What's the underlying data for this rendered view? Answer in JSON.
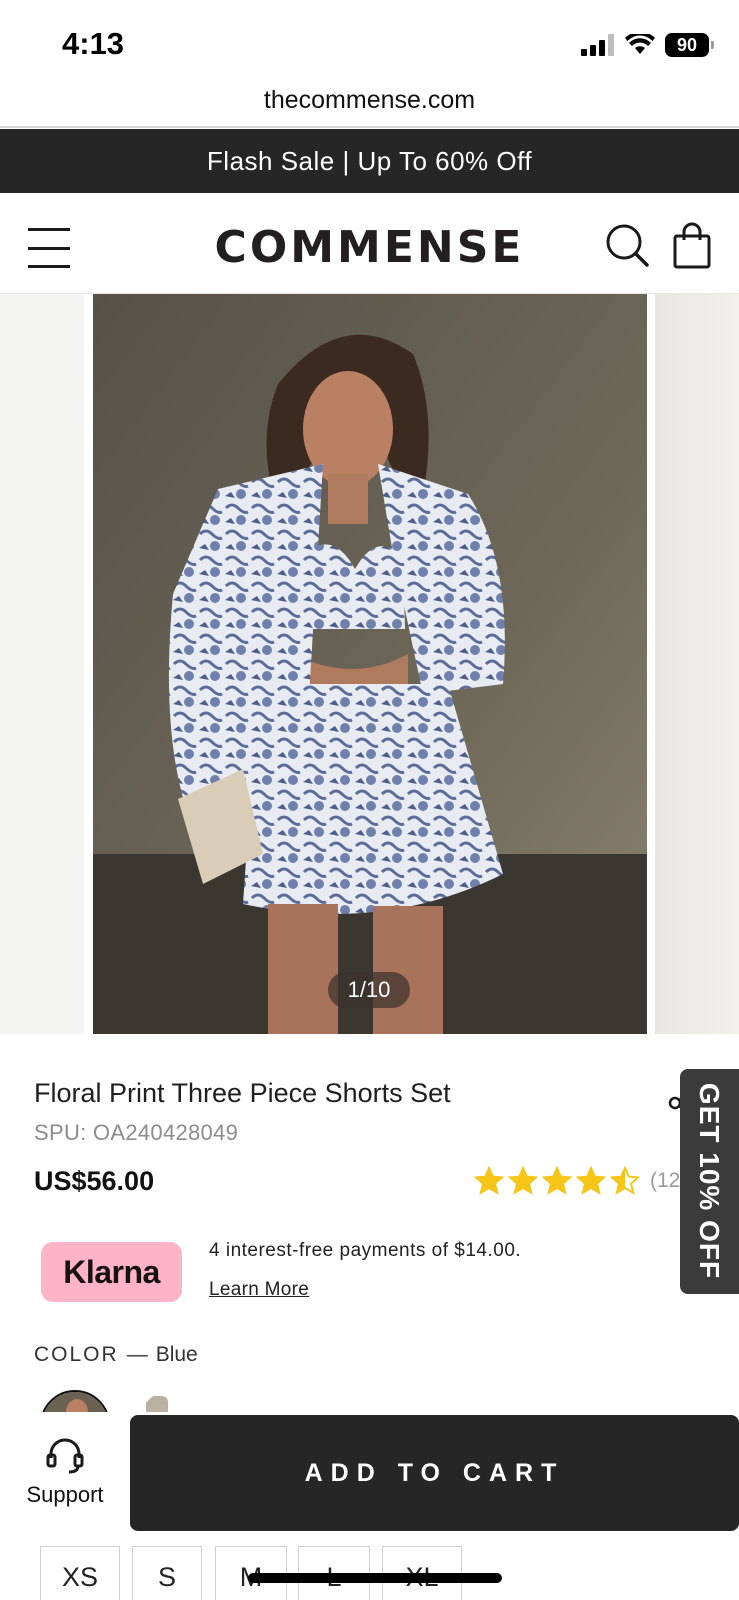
{
  "status_bar": {
    "time": "4:13",
    "battery": "90"
  },
  "browser": {
    "url": "thecommense.com"
  },
  "promo": {
    "text": "Flash Sale | Up To 60% Off"
  },
  "header": {
    "logo": "COMMENSE"
  },
  "gallery": {
    "counter": "1/10"
  },
  "product": {
    "title": "Floral Print Three Piece Shorts Set",
    "spu": "SPU: OA240428049",
    "price": "US$56.00",
    "rating": 4.5,
    "rating_count": "(12)"
  },
  "side_tab": {
    "label": "GET 10% OFF"
  },
  "klarna": {
    "badge": "Klarna",
    "text": "4 interest-free payments of $14.00.",
    "link": "Learn More"
  },
  "color": {
    "label": "COLOR",
    "separator": "—",
    "value": "Blue"
  },
  "bottom_bar": {
    "support_label": "Support",
    "add_to_cart": "ADD TO CART"
  },
  "sizes": [
    "XS",
    "S",
    "M",
    "L",
    "XL"
  ],
  "colors": {
    "accent_dark": "#262626",
    "klarna_pink": "#ffb3c7",
    "star": "#f5c518"
  }
}
